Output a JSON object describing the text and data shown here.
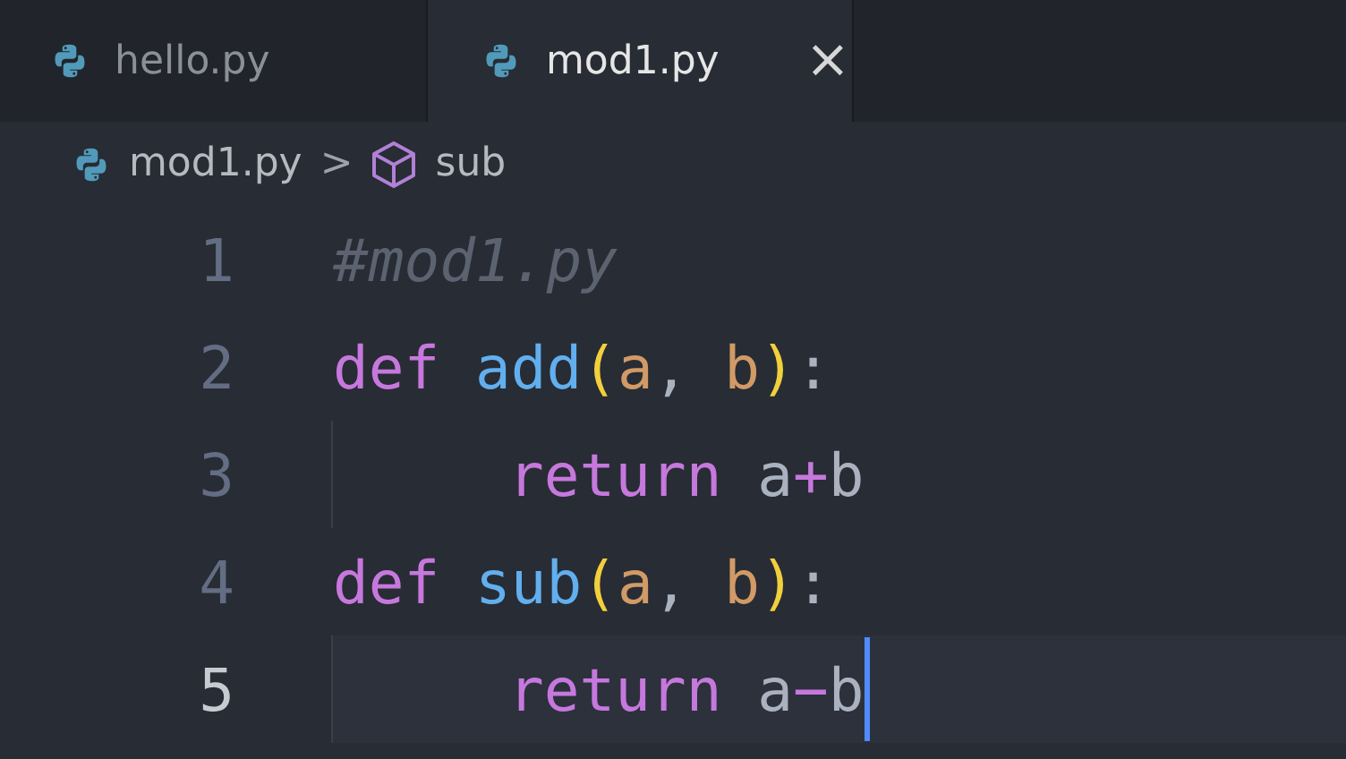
{
  "tabs": [
    {
      "label": "hello.py",
      "selected": false
    },
    {
      "label": "mod1.py",
      "selected": true,
      "close": "×"
    }
  ],
  "breadcrumb": {
    "file": "mod1.py",
    "separator": ">",
    "symbol": "sub"
  },
  "editor": {
    "lines": [
      {
        "number": "1",
        "indented": false,
        "selected": false,
        "tokens": [
          {
            "kind": "comment",
            "text": "#mod1.py"
          }
        ]
      },
      {
        "number": "2",
        "indented": false,
        "selected": false,
        "tokens": [
          {
            "kind": "keyword",
            "text": "def "
          },
          {
            "kind": "function",
            "text": "add"
          },
          {
            "kind": "bracket",
            "text": "("
          },
          {
            "kind": "param",
            "text": "a"
          },
          {
            "kind": "plain",
            "text": ", "
          },
          {
            "kind": "param",
            "text": "b"
          },
          {
            "kind": "bracket",
            "text": ")"
          },
          {
            "kind": "plain",
            "text": ":"
          }
        ]
      },
      {
        "number": "3",
        "indented": true,
        "selected": false,
        "tokens": [
          {
            "kind": "keyword",
            "text": "return"
          },
          {
            "kind": "plain",
            "text": " a"
          },
          {
            "kind": "operator",
            "text": "+"
          },
          {
            "kind": "plain",
            "text": "b"
          }
        ]
      },
      {
        "number": "4",
        "indented": false,
        "selected": false,
        "tokens": [
          {
            "kind": "keyword",
            "text": "def "
          },
          {
            "kind": "function",
            "text": "sub"
          },
          {
            "kind": "bracket",
            "text": "("
          },
          {
            "kind": "param",
            "text": "a"
          },
          {
            "kind": "plain",
            "text": ", "
          },
          {
            "kind": "param",
            "text": "b"
          },
          {
            "kind": "bracket",
            "text": ")"
          },
          {
            "kind": "plain",
            "text": ":"
          }
        ]
      },
      {
        "number": "5",
        "indented": true,
        "selected": true,
        "tokens": [
          {
            "kind": "keyword",
            "text": "return"
          },
          {
            "kind": "plain",
            "text": " a"
          },
          {
            "kind": "operator",
            "text": "−"
          },
          {
            "kind": "plain",
            "text": "b"
          }
        ]
      }
    ]
  }
}
